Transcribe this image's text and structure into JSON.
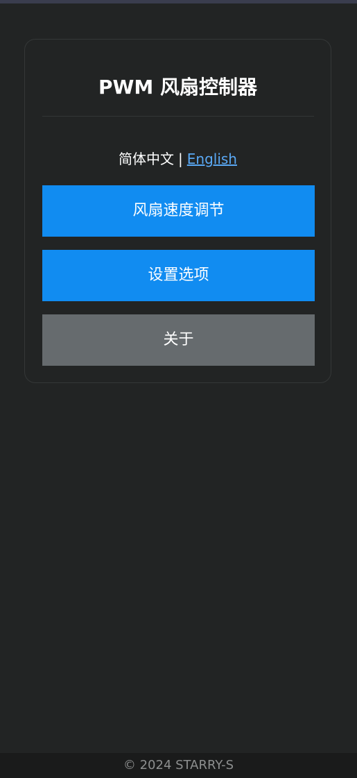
{
  "header": {
    "title": "PWM 风扇控制器"
  },
  "language": {
    "current": "简体中文",
    "separator": "|",
    "alternate": "English"
  },
  "menu": {
    "items": [
      {
        "label": "风扇速度调节"
      },
      {
        "label": "设置选项"
      },
      {
        "label": "关于"
      }
    ]
  },
  "footer": {
    "copyright": "© 2024 STARRY-S"
  },
  "colors": {
    "background": "#222424",
    "primary_button": "#118cf1",
    "secondary_button": "#666b6e",
    "link": "#5aa9f5"
  }
}
